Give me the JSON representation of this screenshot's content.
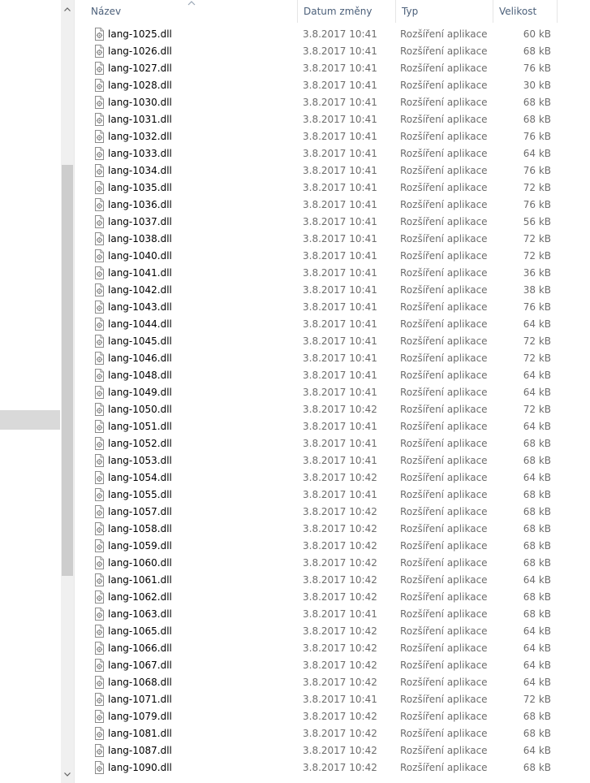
{
  "header": {
    "name": "Název",
    "date": "Datum změny",
    "type": "Typ",
    "size": "Velikost"
  },
  "icons": {
    "file_type": "dll-file-icon",
    "sort": "sort-ascending-chevron-icon"
  },
  "files": [
    {
      "name": "lang-1025.dll",
      "date": "3.8.2017 10:41",
      "type": "Rozšíření aplikace",
      "size": "60 kB"
    },
    {
      "name": "lang-1026.dll",
      "date": "3.8.2017 10:41",
      "type": "Rozšíření aplikace",
      "size": "68 kB"
    },
    {
      "name": "lang-1027.dll",
      "date": "3.8.2017 10:41",
      "type": "Rozšíření aplikace",
      "size": "76 kB"
    },
    {
      "name": "lang-1028.dll",
      "date": "3.8.2017 10:41",
      "type": "Rozšíření aplikace",
      "size": "30 kB"
    },
    {
      "name": "lang-1030.dll",
      "date": "3.8.2017 10:41",
      "type": "Rozšíření aplikace",
      "size": "68 kB"
    },
    {
      "name": "lang-1031.dll",
      "date": "3.8.2017 10:41",
      "type": "Rozšíření aplikace",
      "size": "68 kB"
    },
    {
      "name": "lang-1032.dll",
      "date": "3.8.2017 10:41",
      "type": "Rozšíření aplikace",
      "size": "76 kB"
    },
    {
      "name": "lang-1033.dll",
      "date": "3.8.2017 10:41",
      "type": "Rozšíření aplikace",
      "size": "64 kB"
    },
    {
      "name": "lang-1034.dll",
      "date": "3.8.2017 10:41",
      "type": "Rozšíření aplikace",
      "size": "76 kB"
    },
    {
      "name": "lang-1035.dll",
      "date": "3.8.2017 10:41",
      "type": "Rozšíření aplikace",
      "size": "72 kB"
    },
    {
      "name": "lang-1036.dll",
      "date": "3.8.2017 10:41",
      "type": "Rozšíření aplikace",
      "size": "76 kB"
    },
    {
      "name": "lang-1037.dll",
      "date": "3.8.2017 10:41",
      "type": "Rozšíření aplikace",
      "size": "56 kB"
    },
    {
      "name": "lang-1038.dll",
      "date": "3.8.2017 10:41",
      "type": "Rozšíření aplikace",
      "size": "72 kB"
    },
    {
      "name": "lang-1040.dll",
      "date": "3.8.2017 10:41",
      "type": "Rozšíření aplikace",
      "size": "72 kB"
    },
    {
      "name": "lang-1041.dll",
      "date": "3.8.2017 10:41",
      "type": "Rozšíření aplikace",
      "size": "36 kB"
    },
    {
      "name": "lang-1042.dll",
      "date": "3.8.2017 10:41",
      "type": "Rozšíření aplikace",
      "size": "38 kB"
    },
    {
      "name": "lang-1043.dll",
      "date": "3.8.2017 10:41",
      "type": "Rozšíření aplikace",
      "size": "76 kB"
    },
    {
      "name": "lang-1044.dll",
      "date": "3.8.2017 10:41",
      "type": "Rozšíření aplikace",
      "size": "64 kB"
    },
    {
      "name": "lang-1045.dll",
      "date": "3.8.2017 10:41",
      "type": "Rozšíření aplikace",
      "size": "72 kB"
    },
    {
      "name": "lang-1046.dll",
      "date": "3.8.2017 10:41",
      "type": "Rozšíření aplikace",
      "size": "72 kB"
    },
    {
      "name": "lang-1048.dll",
      "date": "3.8.2017 10:41",
      "type": "Rozšíření aplikace",
      "size": "64 kB"
    },
    {
      "name": "lang-1049.dll",
      "date": "3.8.2017 10:41",
      "type": "Rozšíření aplikace",
      "size": "64 kB"
    },
    {
      "name": "lang-1050.dll",
      "date": "3.8.2017 10:42",
      "type": "Rozšíření aplikace",
      "size": "72 kB"
    },
    {
      "name": "lang-1051.dll",
      "date": "3.8.2017 10:41",
      "type": "Rozšíření aplikace",
      "size": "64 kB"
    },
    {
      "name": "lang-1052.dll",
      "date": "3.8.2017 10:41",
      "type": "Rozšíření aplikace",
      "size": "68 kB"
    },
    {
      "name": "lang-1053.dll",
      "date": "3.8.2017 10:41",
      "type": "Rozšíření aplikace",
      "size": "68 kB"
    },
    {
      "name": "lang-1054.dll",
      "date": "3.8.2017 10:42",
      "type": "Rozšíření aplikace",
      "size": "64 kB"
    },
    {
      "name": "lang-1055.dll",
      "date": "3.8.2017 10:41",
      "type": "Rozšíření aplikace",
      "size": "68 kB"
    },
    {
      "name": "lang-1057.dll",
      "date": "3.8.2017 10:42",
      "type": "Rozšíření aplikace",
      "size": "68 kB"
    },
    {
      "name": "lang-1058.dll",
      "date": "3.8.2017 10:42",
      "type": "Rozšíření aplikace",
      "size": "68 kB"
    },
    {
      "name": "lang-1059.dll",
      "date": "3.8.2017 10:42",
      "type": "Rozšíření aplikace",
      "size": "68 kB"
    },
    {
      "name": "lang-1060.dll",
      "date": "3.8.2017 10:42",
      "type": "Rozšíření aplikace",
      "size": "68 kB"
    },
    {
      "name": "lang-1061.dll",
      "date": "3.8.2017 10:42",
      "type": "Rozšíření aplikace",
      "size": "64 kB"
    },
    {
      "name": "lang-1062.dll",
      "date": "3.8.2017 10:42",
      "type": "Rozšíření aplikace",
      "size": "68 kB"
    },
    {
      "name": "lang-1063.dll",
      "date": "3.8.2017 10:41",
      "type": "Rozšíření aplikace",
      "size": "68 kB"
    },
    {
      "name": "lang-1065.dll",
      "date": "3.8.2017 10:42",
      "type": "Rozšíření aplikace",
      "size": "64 kB"
    },
    {
      "name": "lang-1066.dll",
      "date": "3.8.2017 10:42",
      "type": "Rozšíření aplikace",
      "size": "64 kB"
    },
    {
      "name": "lang-1067.dll",
      "date": "3.8.2017 10:42",
      "type": "Rozšíření aplikace",
      "size": "64 kB"
    },
    {
      "name": "lang-1068.dll",
      "date": "3.8.2017 10:42",
      "type": "Rozšíření aplikace",
      "size": "64 kB"
    },
    {
      "name": "lang-1071.dll",
      "date": "3.8.2017 10:41",
      "type": "Rozšíření aplikace",
      "size": "72 kB"
    },
    {
      "name": "lang-1079.dll",
      "date": "3.8.2017 10:42",
      "type": "Rozšíření aplikace",
      "size": "68 kB"
    },
    {
      "name": "lang-1081.dll",
      "date": "3.8.2017 10:42",
      "type": "Rozšíření aplikace",
      "size": "68 kB"
    },
    {
      "name": "lang-1087.dll",
      "date": "3.8.2017 10:42",
      "type": "Rozšíření aplikace",
      "size": "64 kB"
    },
    {
      "name": "lang-1090.dll",
      "date": "3.8.2017 10:42",
      "type": "Rozšíření aplikace",
      "size": "68 kB"
    }
  ]
}
